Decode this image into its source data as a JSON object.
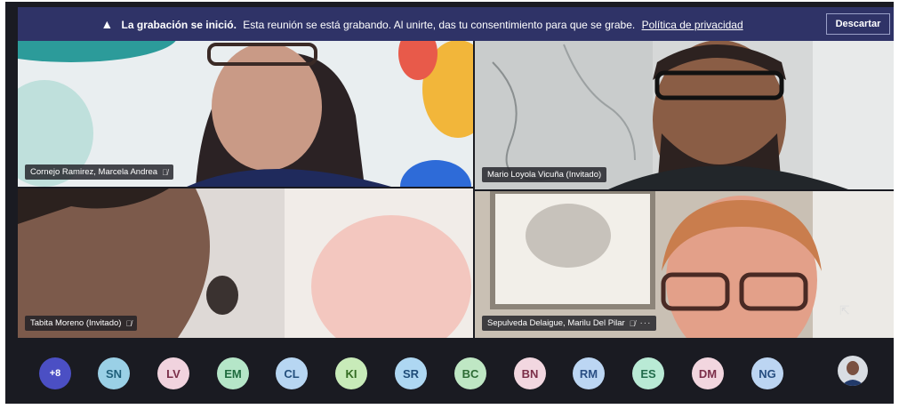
{
  "banner": {
    "bold": "La grabación se inició.",
    "text": "Esta reunión se está grabando. Al unirte, das tu consentimiento para que se grabe.",
    "link": "Política de privacidad",
    "dismiss": "Descartar"
  },
  "tiles": [
    {
      "name": "Cornejo Ramirez, Marcela Andrea",
      "muted": true
    },
    {
      "name": "Mario Loyola Vicuña (Invitado)",
      "muted": false
    },
    {
      "name": "Tabita Moreno (Invitado)",
      "muted": true
    },
    {
      "name": "Sepulveda Delaigue, Marilu Del Pilar",
      "muted": true,
      "more": "···"
    }
  ],
  "tray": {
    "more_label": "+8",
    "avatars": [
      {
        "initials": "SN",
        "bg": "#9ad0e6",
        "fg": "#1f5f7a"
      },
      {
        "initials": "LV",
        "bg": "#f1d3de",
        "fg": "#7a2f49"
      },
      {
        "initials": "EM",
        "bg": "#b5e6c8",
        "fg": "#1f6b3e"
      },
      {
        "initials": "CL",
        "bg": "#b7d6f2",
        "fg": "#24507d"
      },
      {
        "initials": "KI",
        "bg": "#c8ebb9",
        "fg": "#336b22"
      },
      {
        "initials": "SR",
        "bg": "#aed7f2",
        "fg": "#1e4c78"
      },
      {
        "initials": "BC",
        "bg": "#bfe7c4",
        "fg": "#2d6b34"
      },
      {
        "initials": "BN",
        "bg": "#f2d7e0",
        "fg": "#7b2e48"
      },
      {
        "initials": "RM",
        "bg": "#bcd6f3",
        "fg": "#2b4f84"
      },
      {
        "initials": "ES",
        "bg": "#b9ead5",
        "fg": "#216b4b"
      },
      {
        "initials": "DM",
        "bg": "#f2d6df",
        "fg": "#7c2f4a"
      },
      {
        "initials": "NG",
        "bg": "#bcd5f2",
        "fg": "#274e80"
      }
    ]
  },
  "icons": {
    "warning": "warning-icon",
    "mic_off": "mic-off-icon",
    "cursor": "mouse-cursor-icon"
  }
}
